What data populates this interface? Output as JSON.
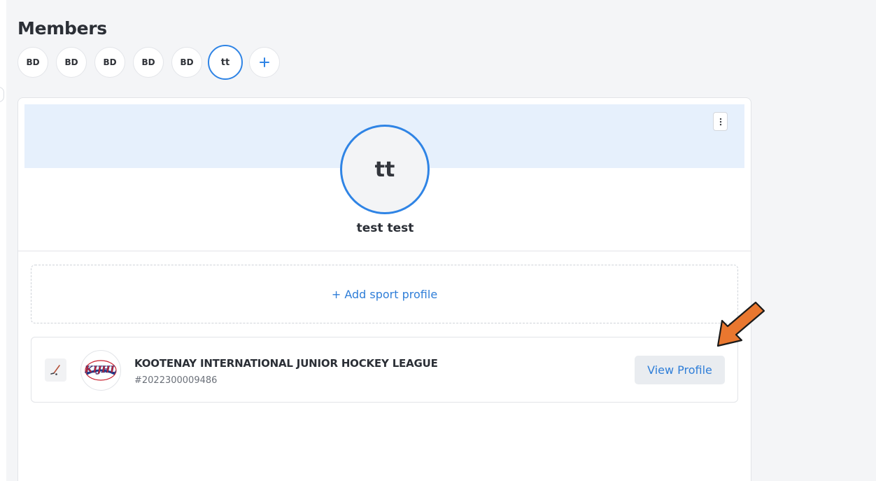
{
  "header": {
    "title": "Members"
  },
  "members": [
    {
      "initials": "BD",
      "selected": false
    },
    {
      "initials": "BD",
      "selected": false
    },
    {
      "initials": "BD",
      "selected": false
    },
    {
      "initials": "BD",
      "selected": false
    },
    {
      "initials": "BD",
      "selected": false
    },
    {
      "initials": "tt",
      "selected": true
    }
  ],
  "add_member_icon": "plus-icon",
  "profile": {
    "initials": "tt",
    "name": "test test",
    "menu_icon": "kebab-menu-icon"
  },
  "add_sport_profile_label": "+ Add sport profile",
  "sport_profiles": [
    {
      "sport_icon": "hockey-stick-icon",
      "logo_text": "KIJHL",
      "league_name": "KOOTENAY INTERNATIONAL JUNIOR HOCKEY LEAGUE",
      "member_id": "#2022300009486",
      "button_label": "View Profile"
    }
  ],
  "annotation": {
    "icon": "orange-arrow-icon",
    "color": "#e9772f"
  },
  "colors": {
    "accent": "#2f84e5",
    "link": "#2f7ed8",
    "banner": "#e6f0fc"
  }
}
